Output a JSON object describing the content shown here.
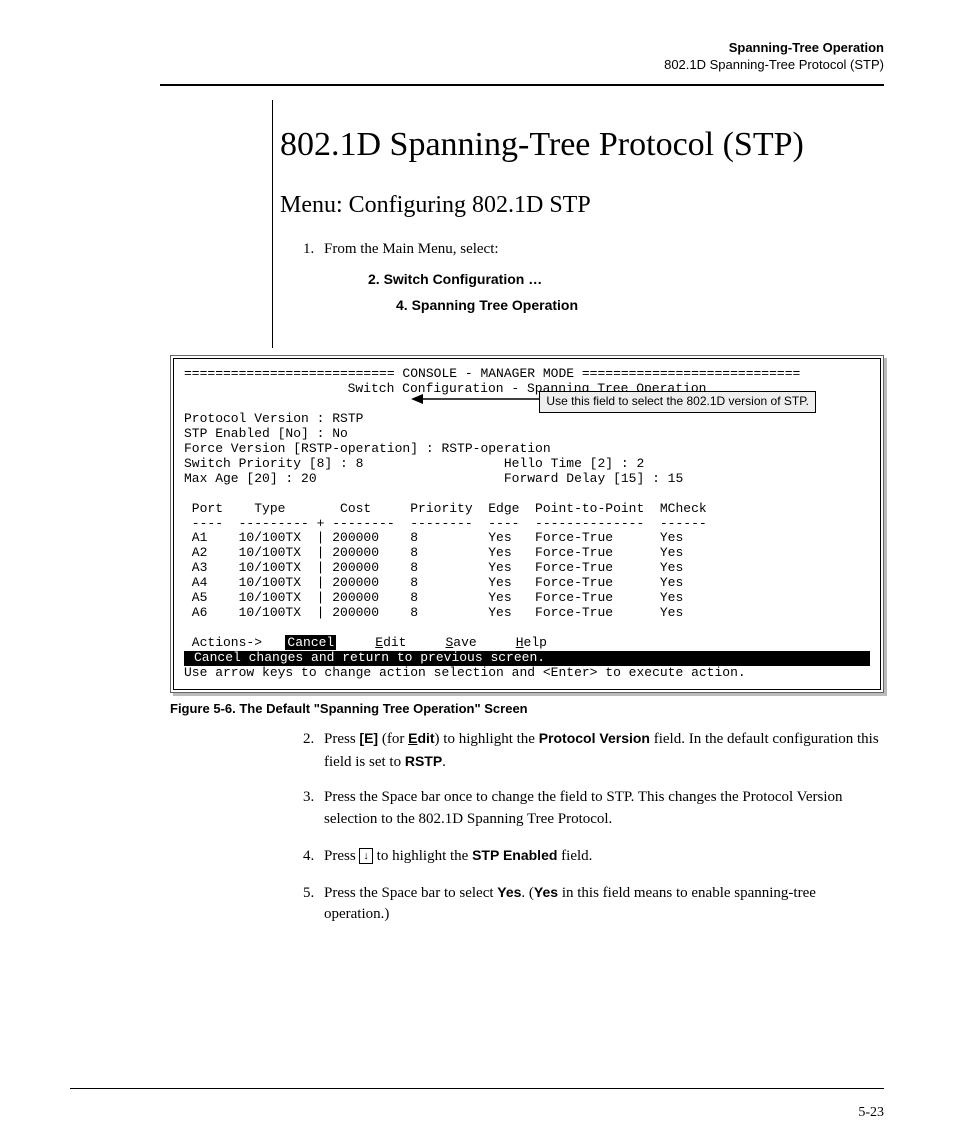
{
  "header": {
    "title": "Spanning-Tree Operation",
    "subtitle": "802.1D Spanning-Tree Protocol (STP)"
  },
  "h1": "802.1D Spanning-Tree Protocol (STP)",
  "h2": "Menu: Configuring 802.1D STP",
  "step1_intro": "From the Main Menu, select:",
  "menu_step_2": "2. Switch Configuration …",
  "menu_step_4": "4. Spanning Tree Operation",
  "console": {
    "header_line": "=========================== CONSOLE - MANAGER MODE ============================",
    "title_line": "Switch Configuration - Spanning Tree Operation",
    "protocol_line": "Protocol Version : RSTP",
    "callout": "Use this field to select the 802.1D version of STP.",
    "params_block": "STP Enabled [No] : No\nForce Version [RSTP-operation] : RSTP-operation\nSwitch Priority [8] : 8                  Hello Time [2] : 2\nMax Age [20] : 20                        Forward Delay [15] : 15",
    "columns": " Port    Type       Cost     Priority  Edge  Point-to-Point  MCheck",
    "sep": " ----  --------- + --------  --------  ----  --------------  ------",
    "rows": [
      " A1    10/100TX  | 200000    8         Yes   Force-True      Yes",
      " A2    10/100TX  | 200000    8         Yes   Force-True      Yes",
      " A3    10/100TX  | 200000    8         Yes   Force-True      Yes",
      " A4    10/100TX  | 200000    8         Yes   Force-True      Yes",
      " A5    10/100TX  | 200000    8         Yes   Force-True      Yes",
      " A6    10/100TX  | 200000    8         Yes   Force-True      Yes"
    ],
    "actions_label": " Actions->   ",
    "action_cancel": "Cancel",
    "action_edit_u": "E",
    "action_edit_rest": "dit",
    "action_save_u": "S",
    "action_save_rest": "ave",
    "action_help_u": "H",
    "action_help_rest": "elp",
    "status_line": "Cancel changes and return to previous screen.                                 ",
    "hint_line": "Use arrow keys to change action selection and <Enter> to execute action."
  },
  "figure_caption": "Figure 5-6. The Default \"Spanning Tree Operation\" Screen",
  "steps": {
    "s2_a": "Press ",
    "s2_key": "[E]",
    "s2_b": " (for ",
    "s2_edit_u": "E",
    "s2_edit_rest": "dit",
    "s2_c": ") to highlight the ",
    "s2_field": "Protocol Version",
    "s2_d": " field. In the default configuration this field is set to ",
    "s2_rstp": "RSTP",
    "s2_e": ".",
    "s3": "Press the Space bar once to change the field to STP. This changes the Protocol Version selection to the 802.1D Spanning Tree Protocol.",
    "s4_a": "Press ",
    "s4_key": "↓",
    "s4_b": " to highlight the ",
    "s4_field": "STP Enabled",
    "s4_c": " field.",
    "s5_a": "Press the Space bar to select ",
    "s5_yes": "Yes",
    "s5_b": ". (",
    "s5_yes2": "Yes",
    "s5_c": " in this field means to enable spanning-tree operation.)"
  },
  "page_number": "5-23"
}
